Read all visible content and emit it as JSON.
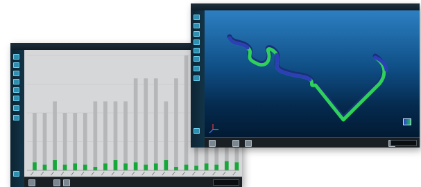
{
  "windows": [
    {
      "id": "chart-window",
      "title": "",
      "app_name": ""
    },
    {
      "id": "viewer-window",
      "title": "",
      "app_name": ""
    }
  ],
  "chart_data": {
    "type": "bar",
    "categories": [
      "1",
      "2",
      "3",
      "4",
      "5",
      "6",
      "7",
      "8",
      "9",
      "10",
      "11",
      "12",
      "13",
      "14",
      "15",
      "16",
      "17",
      "18",
      "19",
      "20",
      "21",
      "22",
      "23",
      "24",
      "25",
      "26",
      "27",
      "28",
      "29",
      "30",
      "31",
      "32",
      "33",
      "34",
      "35",
      "36",
      "37",
      "38",
      "39",
      "40",
      "41",
      "42"
    ],
    "series": [
      {
        "values": [
          0,
          7,
          0,
          5,
          0,
          9,
          0,
          5,
          0,
          6,
          0,
          5,
          0,
          3,
          0,
          6,
          0,
          9,
          0,
          6,
          0,
          7,
          0,
          5,
          0,
          6,
          0,
          9,
          0,
          3,
          0,
          5,
          0,
          4,
          0,
          6,
          0,
          5,
          0,
          8,
          0,
          7
        ]
      },
      {
        "values": [
          0,
          50,
          0,
          50,
          0,
          60,
          0,
          50,
          0,
          50,
          0,
          50,
          0,
          60,
          0,
          60,
          0,
          60,
          0,
          60,
          0,
          80,
          0,
          80,
          0,
          80,
          0,
          60,
          0,
          80,
          0,
          100,
          0,
          100,
          0,
          60,
          0,
          100,
          0,
          100,
          0,
          100
        ]
      }
    ],
    "ylim": [
      0,
      100
    ],
    "grid": true,
    "colors": {
      "total": "#b6b7b9",
      "highlight": "#17a83a"
    }
  },
  "viewer": {
    "colors": {
      "green": "#2ed15a",
      "blue": "#2c3fb6"
    },
    "axis_icon": "xyz-axis-icon"
  },
  "colors": {
    "accent": "#2e8fb0",
    "bar_green": "#17a83a"
  }
}
